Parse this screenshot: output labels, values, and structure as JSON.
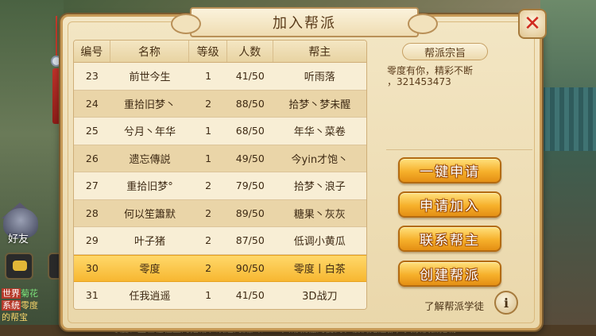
{
  "dialog": {
    "title": "加入帮派",
    "close_label": "✕"
  },
  "table": {
    "headers": {
      "num": "编号",
      "name": "名称",
      "level": "等级",
      "count": "人数",
      "leader": "帮主"
    },
    "rows": [
      {
        "num": "23",
        "name": "前世今生",
        "level": "1",
        "count": "41/50",
        "leader": "听雨落"
      },
      {
        "num": "24",
        "name": "重拾旧梦丶",
        "level": "2",
        "count": "88/50",
        "leader": "拾梦丶梦未醒"
      },
      {
        "num": "25",
        "name": "兮月丶年华",
        "level": "1",
        "count": "68/50",
        "leader": "年华丶菜卷"
      },
      {
        "num": "26",
        "name": "遗忘傳説",
        "level": "1",
        "count": "49/50",
        "leader": "今yin才饱丶"
      },
      {
        "num": "27",
        "name": "重拾旧梦°",
        "level": "2",
        "count": "79/50",
        "leader": "拾梦丶浪子"
      },
      {
        "num": "28",
        "name": "何以笙簫默",
        "level": "2",
        "count": "89/50",
        "leader": "糖果丶灰灰"
      },
      {
        "num": "29",
        "name": "叶子猪",
        "level": "2",
        "count": "87/50",
        "leader": "低调小黄瓜"
      },
      {
        "num": "30",
        "name": "零度",
        "level": "2",
        "count": "90/50",
        "leader": "零度丨白茶",
        "selected": true
      },
      {
        "num": "31",
        "name": "任我逍遥",
        "level": "1",
        "count": "41/50",
        "leader": "3D战刀"
      }
    ]
  },
  "motto": {
    "title": "帮派宗旨",
    "text": "零度有你，精彩不断\n，321453473"
  },
  "actions": {
    "one_click_apply": "一键申请",
    "apply_join": "申请加入",
    "contact_leader": "联系帮主",
    "create_guild": "创建帮派",
    "learn_apprentice": "了解帮派学徒",
    "info_label": "i"
  },
  "sidebar": {
    "friends": "好友",
    "chat_lines": [
      {
        "tag": "世界",
        "text": "菊花"
      },
      {
        "tag": "系统",
        "text": "零度"
      },
      {
        "tag": "",
        "text": "的帮宝"
      }
    ]
  },
  "bottom_ticker": "零度：盖世在位主的挖帮丿欢迎的藏八：　　入帮就懂的要到丿低调无违都，大家快去抢物"
}
